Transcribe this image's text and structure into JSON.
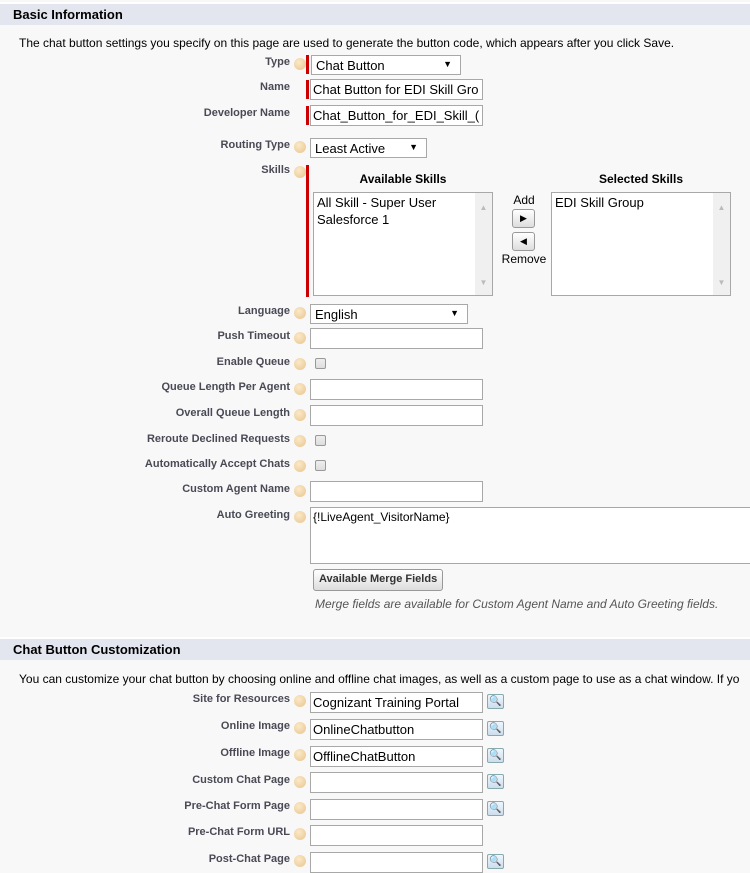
{
  "basic": {
    "title": "Basic Information",
    "description": "The chat button settings you specify on this page are used to generate the button code, which appears after you click Save.",
    "type_label": "Type",
    "type_value": "Chat Button",
    "name_label": "Name",
    "name_value": "Chat Button for EDI Skill Gro",
    "dev_label": "Developer Name",
    "dev_value": "Chat_Button_for_EDI_Skill_(",
    "routing_label": "Routing Type",
    "routing_value": "Least Active",
    "skills_label": "Skills",
    "available_title": "Available Skills",
    "selected_title": "Selected Skills",
    "available": [
      "All Skill - Super User",
      "Salesforce 1"
    ],
    "selected": [
      "EDI Skill Group"
    ],
    "add_label": "Add",
    "remove_label": "Remove",
    "language_label": "Language",
    "language_value": "English",
    "push_label": "Push Timeout",
    "enable_queue_label": "Enable Queue",
    "queue_len_label": "Queue Length Per Agent",
    "overall_label": "Overall Queue Length",
    "reroute_label": "Reroute Declined Requests",
    "auto_accept_label": "Automatically Accept Chats",
    "agent_name_label": "Custom Agent Name",
    "greeting_label": "Auto Greeting",
    "greeting_value": "{!LiveAgent_VisitorName}",
    "merge_button": "Available Merge Fields",
    "merge_note": "Merge fields are available for Custom Agent Name and Auto Greeting fields."
  },
  "custom": {
    "title": "Chat Button Customization",
    "description": "You can customize your chat button by choosing online and offline chat images, as well as a custom page to use as a chat window. If yo",
    "site_label": "Site for Resources",
    "site_value": "Cognizant Training Portal",
    "online_label": "Online Image",
    "online_value": "OnlineChatbutton",
    "offline_label": "Offline Image",
    "offline_value": "OfflineChatButton",
    "chat_page_label": "Custom Chat Page",
    "prechat_label": "Pre-Chat Form Page",
    "prechat_url_label": "Pre-Chat Form URL",
    "postchat_label": "Post-Chat Page"
  },
  "colors": {
    "required": "#cc0000",
    "section_bg": "#e3e6ef"
  }
}
